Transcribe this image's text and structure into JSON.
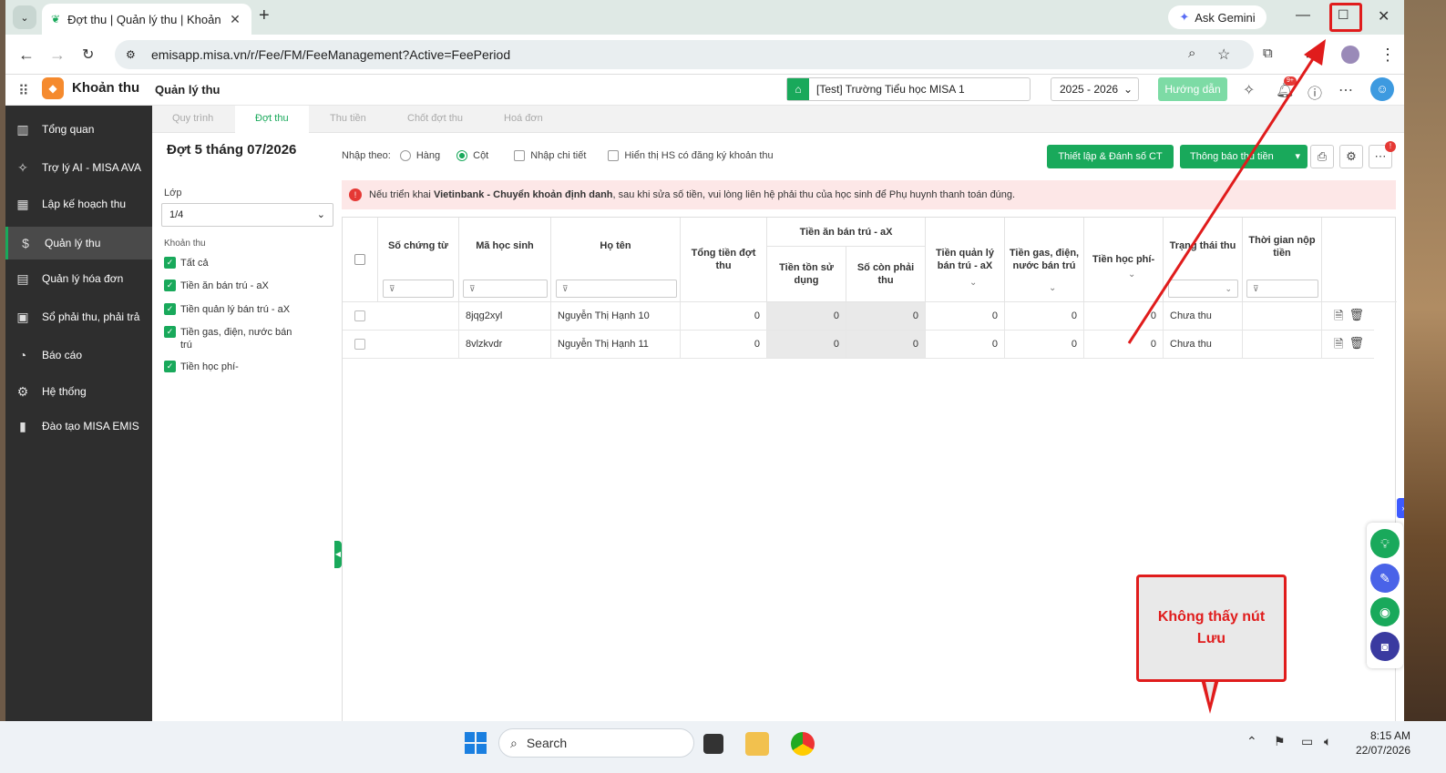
{
  "browser": {
    "tab_title": "Đợt thu | Quản lý thu | Khoản thu",
    "gemini": "Ask Gemini",
    "url": "emisapp.misa.vn/r/Fee/FM/FeeManagement?Active=FeePeriod"
  },
  "app": {
    "name": "Khoản thu",
    "section": "Quản lý thu",
    "school": "[Test] Trường Tiểu học MISA 1",
    "year": "2025 - 2026",
    "guide": "Hướng dẫn",
    "notif_badge": "9+"
  },
  "sidebar": {
    "items": [
      {
        "label": "Tổng quan",
        "icon": "chart-icon"
      },
      {
        "label": "Trợ lý AI - MISA AVA",
        "icon": "sparkle-icon"
      },
      {
        "label": "Lập kế hoạch thu",
        "icon": "calendar-icon"
      },
      {
        "label": "Quản lý thu",
        "icon": "money-hand-icon"
      },
      {
        "label": "Quản lý hóa đơn",
        "icon": "invoice-icon"
      },
      {
        "label": "Sổ phải thu, phải trả",
        "icon": "ledger-icon"
      },
      {
        "label": "Báo cáo",
        "icon": "pie-icon"
      },
      {
        "label": "Hệ thống",
        "icon": "gear-icon"
      },
      {
        "label": "Đào tạo MISA EMIS",
        "icon": "book-icon"
      }
    ]
  },
  "subtabs": [
    "Quy trình",
    "Đợt thu",
    "Thu tiền",
    "Chốt đợt thu",
    "Hoá đơn"
  ],
  "period_title": "Đợt 5 tháng 07/2026",
  "filters": {
    "class_label": "Lớp",
    "class_value": "1/4",
    "fee_label": "Khoản thu",
    "fees": [
      "Tất cả",
      "Tiền ăn bán trú - aX",
      "Tiền quản lý bán trú - aX",
      "Tiền gas, điện, nước bán trú",
      "Tiền học phí-"
    ]
  },
  "options": {
    "input_by": "Nhập theo:",
    "row": "Hàng",
    "col": "Cột",
    "detail": "Nhập chi tiết",
    "show_hs": "Hiển thị HS có đăng ký khoản thu"
  },
  "buttons": {
    "setup": "Thiết lập & Đánh số CT",
    "notify": "Thông báo thu tiền"
  },
  "notice": {
    "prefix": "Nếu triển khai ",
    "bank": "Vietinbank - Chuyển khoản định danh",
    "suffix": ", sau khi sửa số tiền, vui lòng liên hệ phải thu của học sinh để Phụ huynh thanh toán đúng."
  },
  "table": {
    "headers": {
      "so_ct": "Số chứng từ",
      "ma_hs": "Mã học sinh",
      "ho_ten": "Họ tên",
      "tong": "Tổng tiền đợt thu",
      "an_group": "Tiền ăn bán trú - aX",
      "ton": "Tiền tồn sử dụng",
      "con": "Số còn phải thu",
      "ql": "Tiền quản lý bán trú - aX",
      "gas": "Tiền gas, điện, nước bán trú",
      "hp": "Tiền học phí-",
      "tt": "Trạng thái thu",
      "tg": "Thời gian nộp tiền"
    },
    "rows": [
      {
        "ma": "8jqg2xyl",
        "ten": "Nguyễn Thị Hạnh 10",
        "tong": "0",
        "ton": "0",
        "con": "0",
        "ql": "0",
        "gas": "0",
        "hp": "0",
        "tt": "Chưa thu"
      },
      {
        "ma": "8vlzkvdr",
        "ten": "Nguyễn Thị Hạnh 11",
        "tong": "0",
        "ton": "0",
        "con": "0",
        "ql": "0",
        "gas": "0",
        "hp": "0",
        "tt": "Chưa thu"
      }
    ]
  },
  "callout": "Không thấy nút Lưu",
  "taskbar": {
    "search": "Search",
    "time": "8:15 AM",
    "date": "22/07/2026"
  },
  "colors": {
    "brand": "#19a95b",
    "annotation": "#e01c1c"
  }
}
